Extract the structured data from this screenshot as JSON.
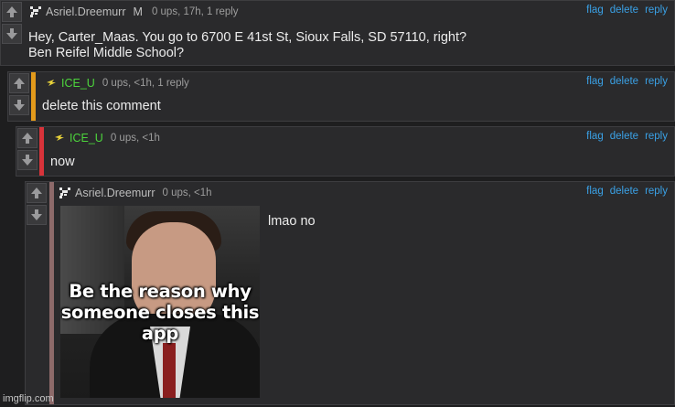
{
  "actions": {
    "flag": "flag",
    "delete": "delete",
    "reply": "reply"
  },
  "colors": {
    "background": "#1e1e1f",
    "comment_bg": "#2a2a2c",
    "link": "#3aa1e6",
    "green_user": "#4cd43c",
    "accent_orange": "#e39a1b",
    "accent_red": "#d8333a",
    "accent_mauve": "#8d6a6a"
  },
  "comments": [
    {
      "user": "Asriel.Dreemurr",
      "user_flag": "M",
      "meta": "0 ups, 17h, 1 reply",
      "text_lines": [
        "Hey, Carter_Maas. You go to 6700 E 41st St, Sioux Falls, SD 57110, right?",
        "Ben Reifel Middle School?"
      ],
      "avatar": "pixel-goat-avatar"
    },
    {
      "user": "ICE_U",
      "meta": "0 ups, <1h, 1 reply",
      "text": "delete this comment",
      "avatar": "lightning-avatar",
      "accent": "#e39a1b"
    },
    {
      "user": "ICE_U",
      "meta": "0 ups, <1h",
      "text": "now",
      "avatar": "lightning-avatar",
      "accent": "#d8333a"
    },
    {
      "user": "Asriel.Dreemurr",
      "meta": "0 ups, <1h",
      "text": "lmao no",
      "avatar": "pixel-goat-avatar",
      "accent": "#8d6a6a",
      "image_caption": "Be the reason why\nsomeone closes this\napp"
    }
  ],
  "watermark": "imgflip.com"
}
